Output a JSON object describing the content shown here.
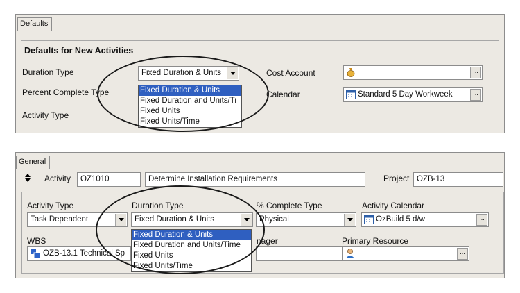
{
  "panel1": {
    "tab": "Defaults",
    "section_title": "Defaults for New Activities",
    "duration_type": {
      "label": "Duration Type",
      "value": "Fixed Duration & Units"
    },
    "percent_complete_type": {
      "label": "Percent Complete Type"
    },
    "activity_type": {
      "label": "Activity Type"
    },
    "dropdown_options": [
      "Fixed Duration & Units",
      "Fixed Duration and Units/Ti",
      "Fixed Units",
      "Fixed Units/Time"
    ],
    "cost_account": {
      "label": "Cost Account",
      "value": ""
    },
    "calendar": {
      "label": "Calendar",
      "value": "Standard 5 Day Workweek"
    },
    "browse_label": "..."
  },
  "panel2": {
    "tab": "General",
    "activity": {
      "label": "Activity",
      "id": "OZ1010",
      "name": "Determine Installation Requirements"
    },
    "project": {
      "label": "Project",
      "value": "OZB-13"
    },
    "activity_type": {
      "label": "Activity Type",
      "value": "Task Dependent"
    },
    "duration_type": {
      "label": "Duration Type",
      "value": "Fixed Duration & Units"
    },
    "percent_complete_type": {
      "label": "% Complete Type",
      "value": "Physical"
    },
    "activity_calendar": {
      "label": "Activity Calendar",
      "value": "OzBuild 5 d/w"
    },
    "wbs": {
      "label": "WBS",
      "value": "OZB-13.1  Technical Sp"
    },
    "manager_partial": "nager",
    "primary_resource": {
      "label": "Primary Resource",
      "value": ""
    },
    "dropdown_options": [
      "Fixed Duration & Units",
      "Fixed Duration and Units/Time",
      "Fixed Units",
      "Fixed Units/Time"
    ],
    "browse_label": "..."
  },
  "colors": {
    "panel_bg": "#ece9e3",
    "selection": "#2f5fc0",
    "border": "#8d8d8d"
  }
}
